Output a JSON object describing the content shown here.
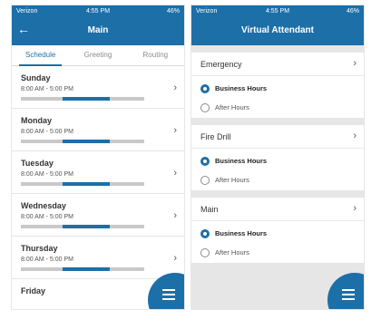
{
  "statusbar": {
    "carrier": "Verizon",
    "time": "4:55 PM",
    "battery": "46%"
  },
  "screen1": {
    "title": "Main",
    "back_icon": "←",
    "tabs": [
      {
        "label": "Schedule",
        "active": true
      },
      {
        "label": "Greeting",
        "active": false
      },
      {
        "label": "Routing",
        "active": false
      }
    ],
    "days": [
      {
        "name": "Sunday",
        "hours": "8:00 AM - 5:00 PM"
      },
      {
        "name": "Monday",
        "hours": "8:00 AM - 5:00 PM"
      },
      {
        "name": "Tuesday",
        "hours": "8:00 AM - 5:00 PM"
      },
      {
        "name": "Wednesday",
        "hours": "8:00 AM - 5:00 PM"
      },
      {
        "name": "Thursday",
        "hours": "8:00 AM - 5:00 PM"
      },
      {
        "name": "Friday",
        "hours": ""
      }
    ],
    "schedule_window": {
      "start_fraction": 0.34,
      "end_fraction": 0.72
    }
  },
  "screen2": {
    "title": "Virtual Attendant",
    "sections": [
      {
        "name": "Emergency",
        "options": [
          {
            "label": "Business Hours",
            "selected": true
          },
          {
            "label": "After Hours",
            "selected": false
          }
        ]
      },
      {
        "name": "Fire Drill",
        "options": [
          {
            "label": "Business Hours",
            "selected": true
          },
          {
            "label": "After Hours",
            "selected": false
          }
        ]
      },
      {
        "name": "Main",
        "options": [
          {
            "label": "Business Hours",
            "selected": true
          },
          {
            "label": "After Hours",
            "selected": false
          }
        ]
      }
    ]
  },
  "colors": {
    "brand": "#1d6fa8",
    "track": "#c9c9c9"
  },
  "icons": {
    "chevron": "›",
    "menu": "hamburger-menu-icon"
  }
}
